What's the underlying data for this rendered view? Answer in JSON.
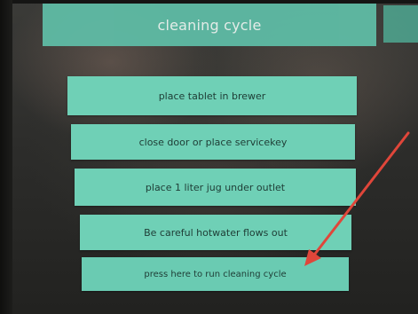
{
  "header": {
    "title": "cleaning cycle"
  },
  "steps": [
    {
      "label": "place tablet in brewer"
    },
    {
      "label": "close door or place servicekey"
    },
    {
      "label": "place 1 liter jug under outlet"
    },
    {
      "label": "Be careful hotwater flows out"
    },
    {
      "label": "press here to run cleaning cycle"
    }
  ],
  "colors": {
    "button_teal": "#6fd0b6",
    "title_teal": "#5fbfa8",
    "annotation_arrow": "#e0463a"
  }
}
